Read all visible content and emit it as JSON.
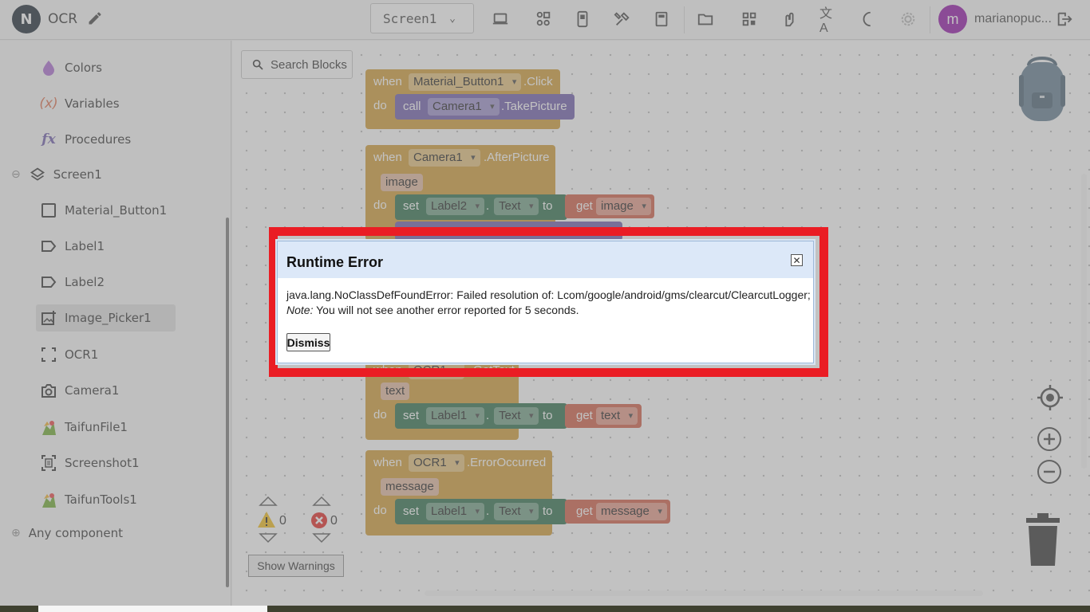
{
  "app": {
    "logo_letter": "N",
    "project_name": "OCR"
  },
  "toolbar": {
    "screen_selector": "Screen1",
    "icons": [
      "laptop-icon",
      "components-icon",
      "phone-icon",
      "build-icon",
      "book-icon",
      "folder-icon",
      "grid-icon",
      "hand-icon",
      "translate-icon",
      "dark-mode-icon",
      "settings-icon"
    ],
    "avatar_letter": "m",
    "username": "marianopuc..."
  },
  "sidebar": {
    "builtin": [
      {
        "label": "Colors",
        "icon": "colors-drop-icon"
      },
      {
        "label": "Variables",
        "icon": "variables-icon",
        "glyph": "(x)"
      },
      {
        "label": "Procedures",
        "icon": "procedures-icon",
        "glyph": "fx"
      }
    ],
    "screen": {
      "label": "Screen1",
      "toggle": "⊖"
    },
    "components": [
      {
        "label": "Material_Button1",
        "icon": "button-icon"
      },
      {
        "label": "Label1",
        "icon": "label-icon"
      },
      {
        "label": "Label2",
        "icon": "label-icon"
      },
      {
        "label": "Image_Picker1",
        "icon": "image-picker-icon",
        "selected": true
      },
      {
        "label": "OCR1",
        "icon": "ocr-icon"
      },
      {
        "label": "Camera1",
        "icon": "camera-icon"
      },
      {
        "label": "TaifunFile1",
        "icon": "taifun-icon"
      },
      {
        "label": "Screenshot1",
        "icon": "screenshot-icon"
      },
      {
        "label": "TaifunTools1",
        "icon": "taifun-icon"
      }
    ],
    "any_component": {
      "label": "Any component",
      "toggle": "⊕"
    }
  },
  "workspace": {
    "search_label": "Search Blocks",
    "blocks": {
      "b1": {
        "when": "when",
        "component": "Material_Button1",
        "event": ".Click",
        "do": "do",
        "call": "call",
        "target": "Camera1",
        "method": ".TakePicture"
      },
      "b2": {
        "when": "when",
        "component": "Camera1",
        "event": ".AfterPicture",
        "param": "image",
        "do": "do",
        "set": "set",
        "target": "Label2",
        "dot": ".",
        "prop": "Text",
        "to": "to",
        "get": "get",
        "var": "image"
      },
      "b3": {
        "when": "when",
        "component": "OCR1",
        "event": ".GotText",
        "param": "text",
        "do": "do",
        "set": "set",
        "target": "Label1",
        "dot": ".",
        "prop": "Text",
        "to": "to",
        "get": "get",
        "var": "text"
      },
      "b4": {
        "when": "when",
        "component": "OCR1",
        "event": ".ErrorOccurred",
        "param": "message",
        "do": "do",
        "set": "set",
        "target": "Label1",
        "dot": ".",
        "prop": "Text",
        "to": "to",
        "get": "get",
        "var": "message"
      }
    },
    "warnings": {
      "warning_count": "0",
      "error_count": "0",
      "show_warnings_label": "Show Warnings"
    }
  },
  "dialog": {
    "title": "Runtime Error",
    "close_glyph": "✕",
    "message": "java.lang.NoClassDefFoundError: Failed resolution of: Lcom/google/android/gms/clearcut/ClearcutLogger;",
    "note_label": "Note:",
    "note_text": " You will not see another error reported for 5 seconds.",
    "dismiss_label": "Dismiss"
  },
  "colors": {
    "highlight_frame": "#ea1d24",
    "event_block": "#d5a545",
    "procedure_block": "#7b6ab3",
    "setter_block": "#3e7b5a",
    "getter_block": "#d56b55",
    "avatar": "#9c27b0"
  }
}
